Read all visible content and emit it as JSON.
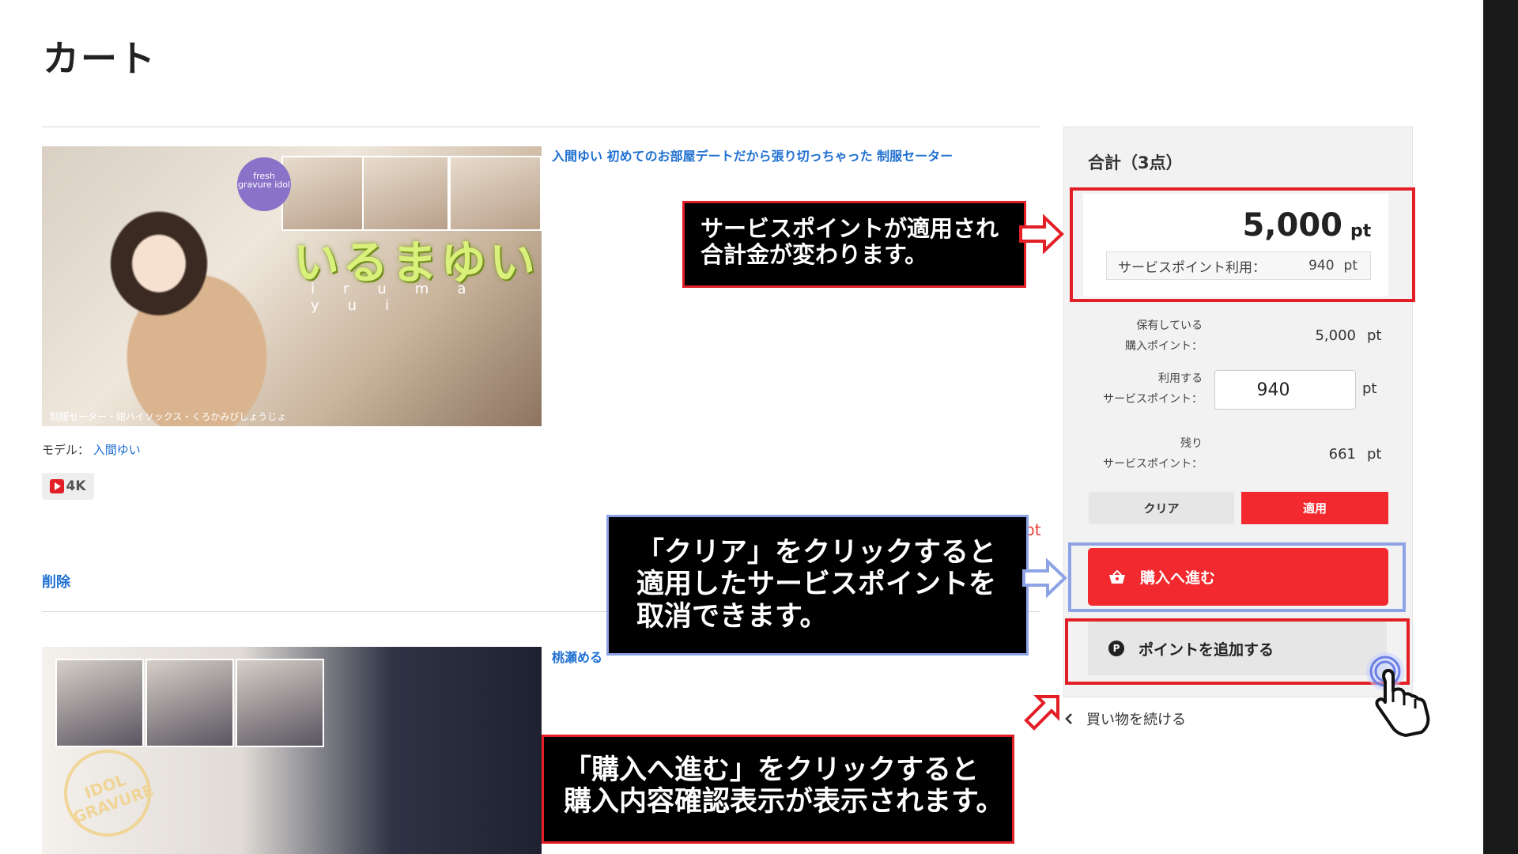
{
  "page": {
    "title": "カート"
  },
  "products": [
    {
      "title": "入間ゆい 初めてのお部屋デートだから張り切っちゃった 制服セーター",
      "image": {
        "badge": "fresh gravure idol",
        "name_jp": "いるまゆい",
        "name_romaji": "iruma yui",
        "caption": "制服セーター・紺ハイソックス・くろかみびしょうじょ"
      },
      "model_label": "モデル：",
      "model_name": "入間ゆい",
      "tag": "4K",
      "delete_label": "削除",
      "price_fragment": "pt"
    },
    {
      "title": "桃瀬める",
      "image": {
        "stamp": "IDOL GRAVURE"
      }
    }
  ],
  "summary": {
    "heading": "合計（3点）",
    "total_value": "5,000",
    "total_unit": "pt",
    "service_used_label": "サービスポイント利用：",
    "service_used_value": "940",
    "service_used_unit": "pt",
    "owned_label_1": "保有している",
    "owned_label_2": "購入ポイント：",
    "owned_value": "5,000",
    "owned_unit": "pt",
    "use_label_1": "利用する",
    "use_label_2": "サービスポイント：",
    "use_input_value": "940",
    "use_unit": "pt",
    "remain_label_1": "残り",
    "remain_label_2": "サービスポイント：",
    "remain_value": "661",
    "remain_unit": "pt",
    "clear_button": "クリア",
    "apply_button": "適用",
    "purchase_button": "購入へ進む",
    "add_points_button": "ポイントを追加する",
    "continue_shopping": "買い物を続ける"
  },
  "annotations": {
    "note1_line1": "サービスポイントが適用され",
    "note1_line2": "合計金が変わります。",
    "note2_line1": "「クリア」をクリックすると",
    "note2_line2": "適用したサービスポイントを",
    "note2_line3": "取消できます。",
    "note3_line1": "「購入へ進む」をクリックすると",
    "note3_line2": "購入内容確認表示が表示されます。"
  },
  "colors": {
    "accent_red": "#f2292e",
    "link_blue": "#1f6fd1",
    "annotation_red": "#e21e26",
    "annotation_blue": "#8da3e6"
  },
  "icons": [
    "basket-icon",
    "point-p-icon",
    "chevron-left-icon",
    "play-icon",
    "hand-pointer-icon",
    "arrow-right-icon",
    "arrow-up-right-icon"
  ]
}
